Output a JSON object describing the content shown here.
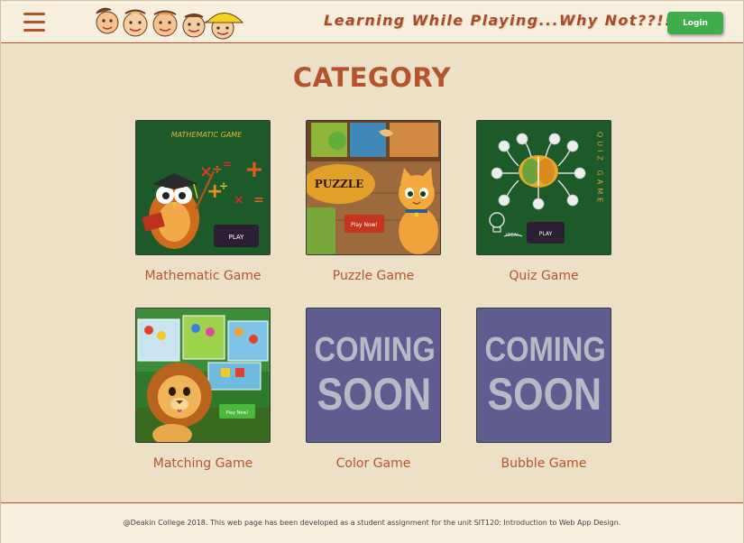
{
  "header": {
    "menu_icon": "hamburger-menu-icon",
    "tagline": "Learning While Playing...Why Not??!!",
    "login_label": "Login",
    "accent": "#b5532d",
    "login_color": "#3fae4a"
  },
  "main": {
    "title": "CATEGORY",
    "cards": [
      {
        "label": "Mathematic Game",
        "thumb_title": "MATHEMATIC  GAME",
        "button": "PLAY"
      },
      {
        "label": "Puzzle Game",
        "thumb_title": "PUZZLE",
        "button": "Play Now!"
      },
      {
        "label": "Quiz Game",
        "thumb_side": "QUIZ GAME",
        "thumb_idea": "IDEA!",
        "button": "PLAY"
      },
      {
        "label": "Matching Game",
        "button": "Play Now!"
      },
      {
        "label": "Color Game",
        "overlay": "COMING SOON"
      },
      {
        "label": "Bubble Game",
        "overlay": "COMING SOON"
      }
    ]
  },
  "footer": {
    "text": "@Deakin College 2018. This web page has been developed as a student assignment for the unit SIT120: Introduction to Web App Design."
  }
}
